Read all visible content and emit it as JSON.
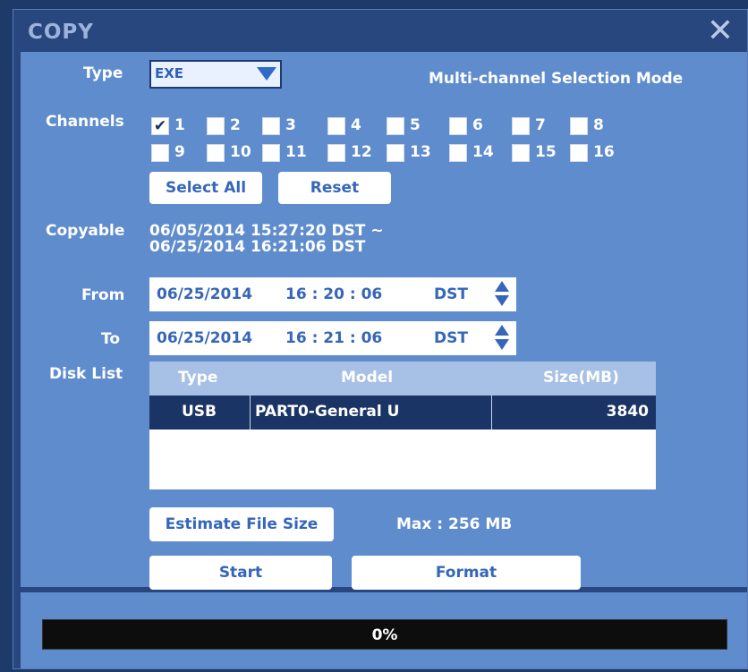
{
  "dialog": {
    "title": "COPY",
    "close_icon": "close-icon"
  },
  "type": {
    "label": "Type",
    "value": "EXE"
  },
  "mode_label": "Multi-channel Selection Mode",
  "channels": {
    "label": "Channels",
    "items": [
      {
        "num": "1",
        "checked": true
      },
      {
        "num": "2",
        "checked": false
      },
      {
        "num": "3",
        "checked": false
      },
      {
        "num": "4",
        "checked": false
      },
      {
        "num": "5",
        "checked": false
      },
      {
        "num": "6",
        "checked": false
      },
      {
        "num": "7",
        "checked": false
      },
      {
        "num": "8",
        "checked": false
      },
      {
        "num": "9",
        "checked": false
      },
      {
        "num": "10",
        "checked": false
      },
      {
        "num": "11",
        "checked": false
      },
      {
        "num": "12",
        "checked": false
      },
      {
        "num": "13",
        "checked": false
      },
      {
        "num": "14",
        "checked": false
      },
      {
        "num": "15",
        "checked": false
      },
      {
        "num": "16",
        "checked": false
      }
    ],
    "check_mark": "✔"
  },
  "buttons": {
    "select_all": "Select All",
    "reset": "Reset",
    "estimate": "Estimate File Size",
    "start": "Start",
    "format": "Format"
  },
  "copyable": {
    "label": "Copyable",
    "line1": "06/05/2014  15:27:20  DST ~",
    "line2": "06/25/2014  16:21:06  DST"
  },
  "from": {
    "label": "From",
    "date": "06/25/2014",
    "time": "16 : 20 : 06",
    "dst": "DST"
  },
  "to": {
    "label": "To",
    "date": "06/25/2014",
    "time": "16 : 21 : 06",
    "dst": "DST"
  },
  "disk_list": {
    "label": "Disk List",
    "columns": [
      "Type",
      "Model",
      "Size(MB)"
    ],
    "rows": [
      {
        "type": "USB",
        "model": "PART0-General U",
        "size": "3840"
      }
    ]
  },
  "max_size": "Max : 256 MB",
  "progress": {
    "value": 0,
    "text": "0%"
  },
  "colors": {
    "panel": "#5f8ccd",
    "frame": "#27477e",
    "selected_row": "#1b3466",
    "header": "#a7c0e6",
    "accent": "#3566b9"
  }
}
